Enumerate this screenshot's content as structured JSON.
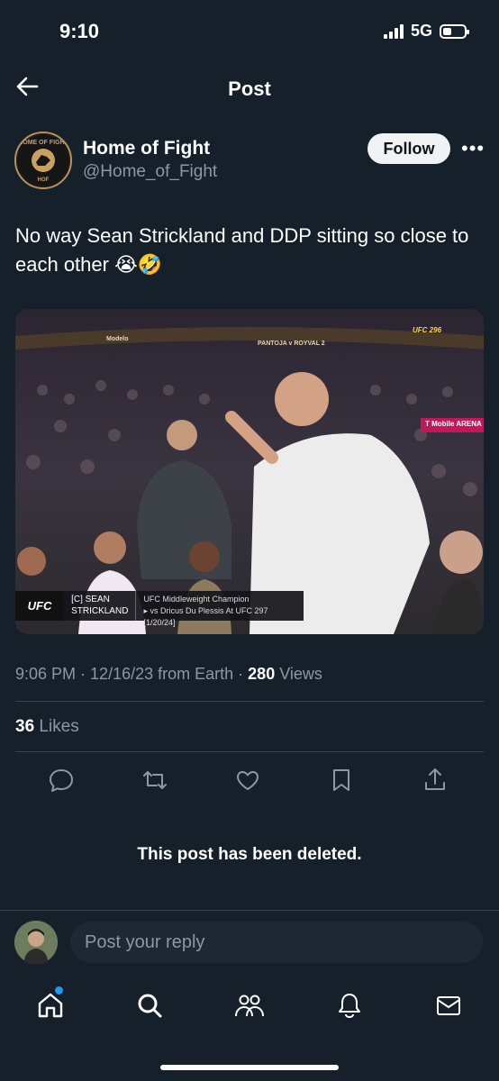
{
  "status_bar": {
    "time": "9:10",
    "network": "5G"
  },
  "header": {
    "title": "Post"
  },
  "author": {
    "name": "Home of Fight",
    "handle": "@Home_of_Fight",
    "logo_text": "HOME OF FIGHT",
    "logo_sub": "HOF"
  },
  "follow_label": "Follow",
  "post": {
    "text": "No way Sean Strickland and DDP sitting so close to each other 😭🤣",
    "media": {
      "banner_left": "Modelo",
      "banner_center": "PANTOJA v ROYVAL 2",
      "banner_right": "UFC 296",
      "arena_sign": "T Mobile ARENA",
      "lower_third": {
        "logo": "UFC",
        "name_line1": "[C] SEAN",
        "name_line2": "STRICKLAND",
        "info_line1": "UFC Middleweight Champion",
        "info_line2": "▸ vs Dricus Du Plessis At UFC 297 [1/20/24]"
      }
    },
    "meta": {
      "time": "9:06 PM",
      "date": "12/16/23",
      "source": "from Earth",
      "views_count": "280",
      "views_label": "Views"
    },
    "likes": {
      "count": "36",
      "label": "Likes"
    }
  },
  "deleted_notice": "This post has been deleted.",
  "reply": {
    "placeholder": "Post your reply"
  },
  "icons": {
    "actions": [
      "reply-icon",
      "repost-icon",
      "like-icon",
      "bookmark-icon",
      "share-icon"
    ],
    "nav": [
      "home-icon",
      "search-icon",
      "communities-icon",
      "notifications-icon",
      "messages-icon"
    ]
  },
  "colors": {
    "background": "#15202b",
    "accent": "#1d9bf0",
    "secondary_text": "#8b98a5",
    "divider": "#38444d"
  }
}
